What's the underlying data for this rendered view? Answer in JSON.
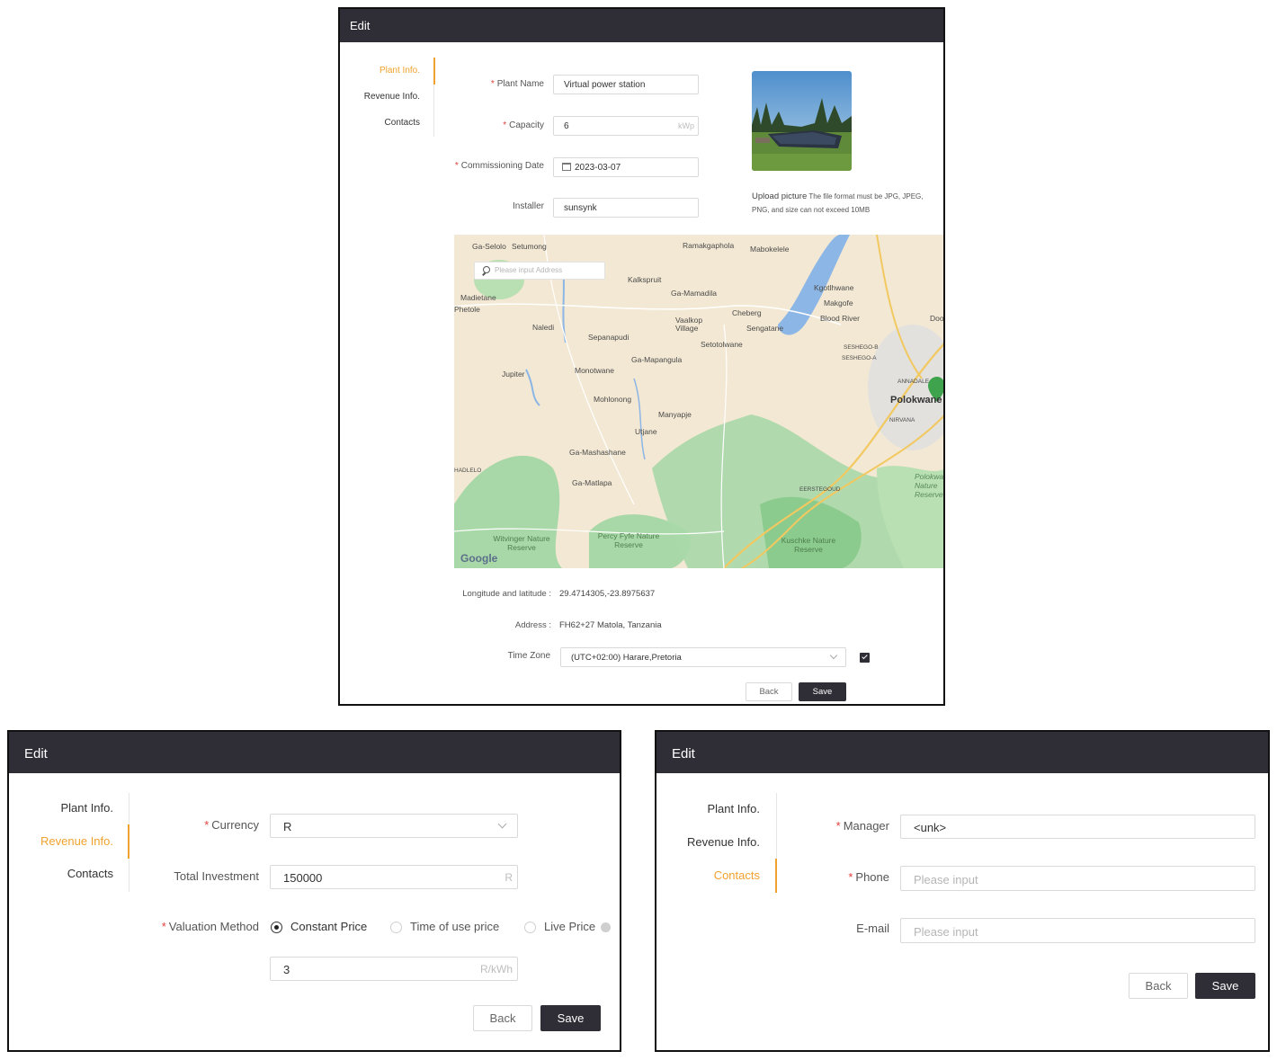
{
  "panel1": {
    "title": "Edit",
    "nav": [
      "Plant Info.",
      "Revenue Info.",
      "Contacts"
    ],
    "plant_name": {
      "label": "Plant Name",
      "value": "Virtual power station"
    },
    "capacity": {
      "label": "Capacity",
      "value": "6",
      "unit": "kWp"
    },
    "commissioning": {
      "label": "Commissioning Date",
      "value": "2023-03-07"
    },
    "installer": {
      "label": "Installer",
      "value": "sunsynk"
    },
    "upload": {
      "title": "Upload picture",
      "hint": "The file format must be JPG, JPEG, PNG, and size can not exceed 10MB"
    },
    "map": {
      "search_placeholder": "Please input Address",
      "google": "Google",
      "places": [
        "Ga-Selolo",
        "Setumong",
        "Ramakgaphola",
        "Mabokelele",
        "Kalkspruit",
        "Ga-Mamadila",
        "Madietane",
        "Phetole",
        "Kgotlhwane",
        "Makgofe",
        "Cheberg",
        "Blood River",
        "Vaalkop Village",
        "Sengatane",
        "Naledi",
        "Sepanapudi",
        "Setotolwane",
        "SESHEGO-B",
        "SESHEGO-A",
        "Ga-Mapangula",
        "Jupiter",
        "Monotwane",
        "ANNADALE",
        "Polokwane",
        "Mohlonong",
        "Manyapje",
        "NIRVANA",
        "Utjane",
        "Ga-Mashashane",
        "HADLELO",
        "Ga-Matlapa",
        "EERSTEGOUD",
        "Polokwane Nature Reserve",
        "Witvinger Nature Reserve",
        "Percy Fyfe Nature Reserve",
        "Kuschke Nature Reserve",
        "Dool"
      ]
    },
    "lonlat": {
      "label": "Longitude and latitude :",
      "value": "29.4714305,-23.8975637"
    },
    "address": {
      "label": "Address :",
      "value": "FH62+27 Matola, Tanzania"
    },
    "timezone": {
      "label": "Time Zone",
      "value": "(UTC+02:00) Harare,Pretoria",
      "checked": true
    },
    "back": "Back",
    "save": "Save"
  },
  "panel2": {
    "title": "Edit",
    "nav": [
      "Plant Info.",
      "Revenue Info.",
      "Contacts"
    ],
    "currency": {
      "label": "Currency",
      "value": "R"
    },
    "investment": {
      "label": "Total Investment",
      "value": "150000",
      "unit": "R"
    },
    "valuation": {
      "label": "Valuation Method",
      "options": [
        "Constant Price",
        "Time of use price",
        "Live Price"
      ],
      "selected": "Constant Price"
    },
    "price": {
      "value": "3",
      "unit": "R/kWh"
    },
    "back": "Back",
    "save": "Save"
  },
  "panel3": {
    "title": "Edit",
    "nav": [
      "Plant Info.",
      "Revenue Info.",
      "Contacts"
    ],
    "manager": {
      "label": "Manager",
      "value": "<unk>"
    },
    "phone": {
      "label": "Phone",
      "placeholder": "Please input"
    },
    "email": {
      "label": "E-mail",
      "placeholder": "Please input"
    },
    "back": "Back",
    "save": "Save"
  },
  "colors": {
    "accent": "#f0a22e",
    "header": "#2f2d35",
    "required": "#e0403c"
  }
}
